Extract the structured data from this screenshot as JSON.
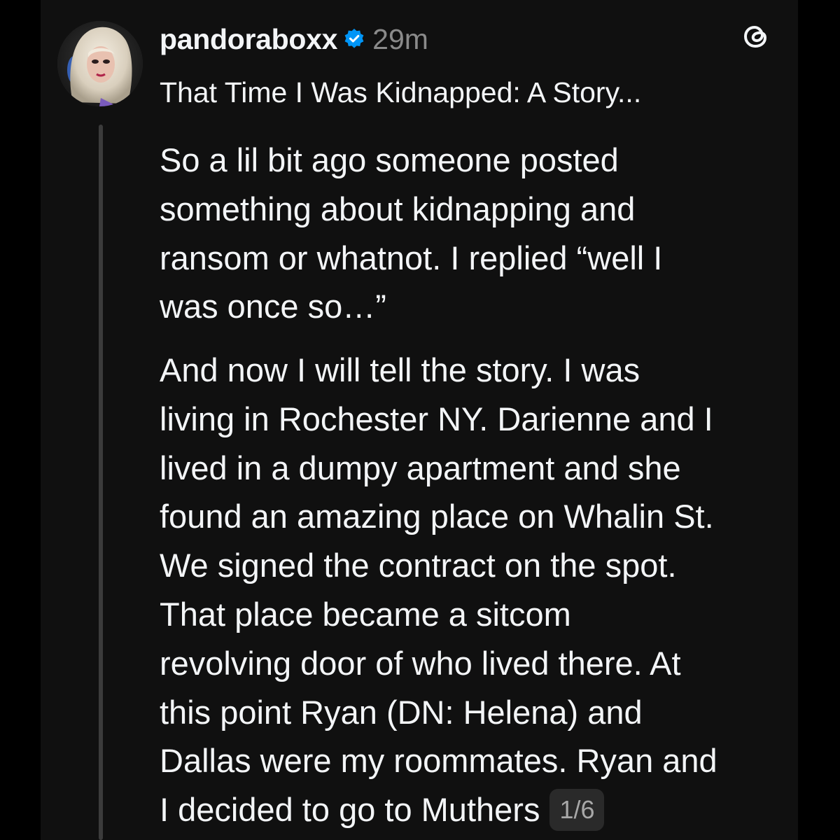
{
  "post": {
    "username": "pandoraboxx",
    "timestamp": "29m",
    "title": "That Time I Was Kidnapped: A Story...",
    "paragraphs": [
      {
        "lines": [
          "So a lil bit ago someone posted",
          "something about kidnapping and",
          "ransom or whatnot. I replied “well I",
          "was once so…”"
        ]
      },
      {
        "lines": [
          "And now I will tell the story. I was",
          "living in Rochester NY. Darienne and I",
          "lived in a dumpy apartment and she",
          "found an amazing place on Whalin St.",
          "We signed the contract on the spot.",
          "That place became a sitcom",
          "revolving door of who lived there. At",
          "this point Ryan (DN: Helena) and",
          "Dallas were my roommates. Ryan and",
          "I decided to go to Muthers"
        ]
      }
    ],
    "thread_counter": "1/6"
  },
  "icons": {
    "verified": "verified-badge-icon",
    "app": "threads-logo-icon"
  },
  "colors": {
    "background": "#101010",
    "text": "#f3f5f7",
    "muted": "#8a8a8a",
    "verified_blue": "#0095f6",
    "counter_bg": "#2a2a2a"
  }
}
